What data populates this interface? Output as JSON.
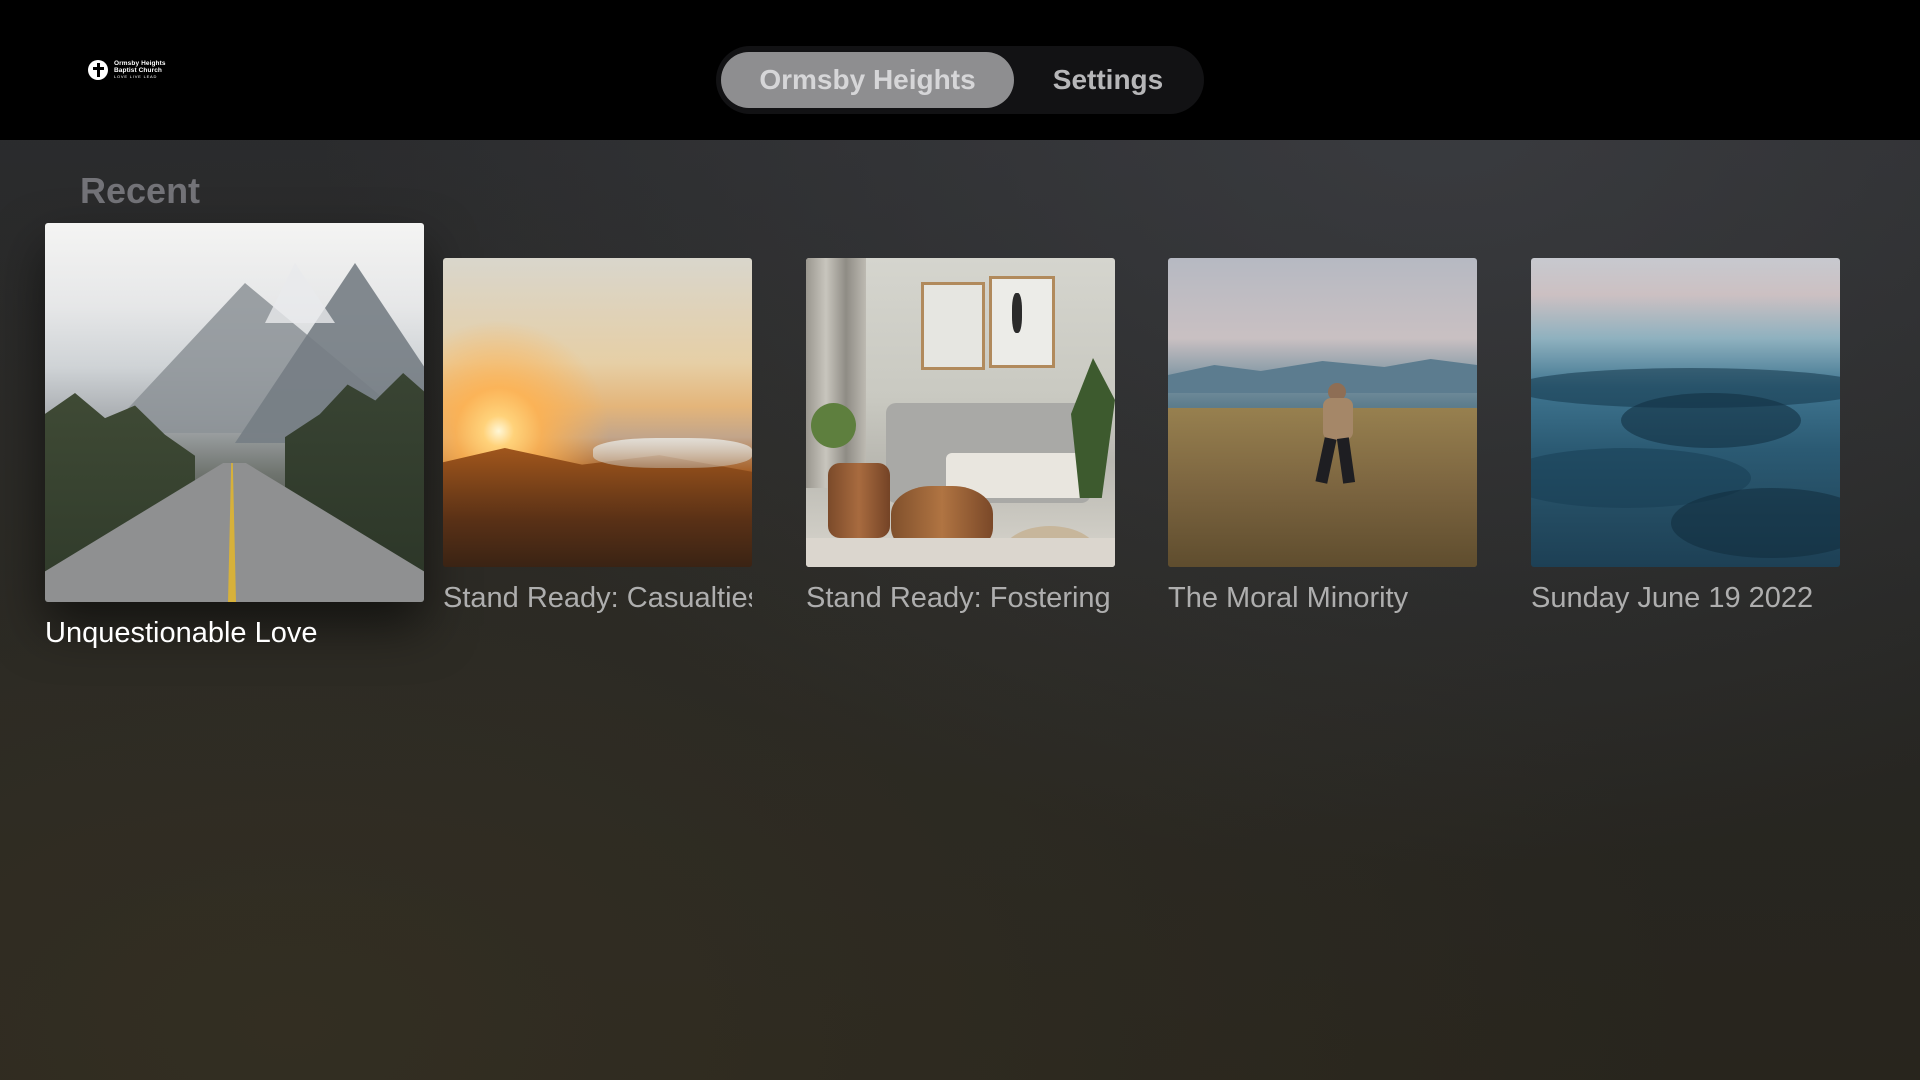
{
  "app": {
    "logo": {
      "line1": "Ormsby Heights",
      "line2": "Baptist Church",
      "tagline": "LOVE LIVE LEAD"
    }
  },
  "nav": {
    "tabs": [
      {
        "label": "Ormsby Heights",
        "active": true
      },
      {
        "label": "Settings",
        "active": false
      }
    ]
  },
  "recent": {
    "title": "Recent",
    "items": [
      {
        "title": "Unquestionable Love",
        "image": "mountain-road",
        "focused": true
      },
      {
        "title": "Stand Ready: Casualties",
        "image": "sunset-mountains",
        "focused": false
      },
      {
        "title": "Stand Ready: Fostering",
        "image": "living-room",
        "focused": false
      },
      {
        "title": "The Moral Minority",
        "image": "man-running-field",
        "focused": false
      },
      {
        "title": "Sunday June 19 2022",
        "image": "ocean-waves",
        "focused": false
      }
    ]
  },
  "colors": {
    "background_top": "#2c2d30",
    "background_bottom": "#28251d",
    "topbar": "#000000",
    "tab_active": "#8e8e90",
    "label_focused": "#ffffff",
    "label_default": "#aeaeae"
  }
}
